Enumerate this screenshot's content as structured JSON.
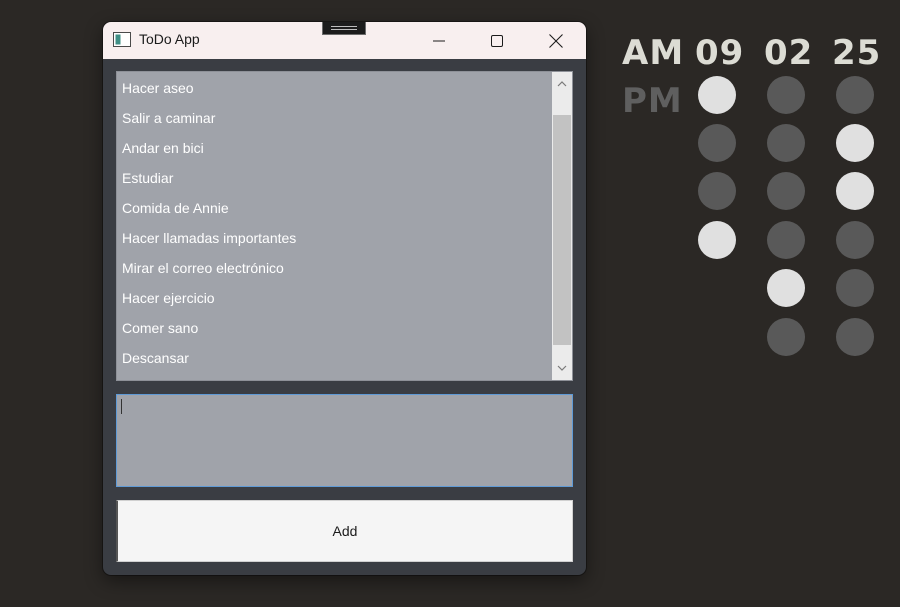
{
  "window": {
    "title": "ToDo App",
    "minimize_icon": "minimize-icon",
    "maximize_icon": "maximize-icon",
    "close_icon": "close-icon"
  },
  "todo_list": {
    "items": [
      "Hacer aseo",
      "Salir a caminar",
      "Andar en bici",
      "Estudiar",
      "Comida de Annie",
      "Hacer llamadas importantes",
      "Mirar el correo electrónico",
      "Hacer ejercicio",
      "Comer sano",
      "Descansar"
    ]
  },
  "new_item_input": {
    "value": ""
  },
  "add_button": {
    "label": "Add"
  },
  "clock": {
    "am_label": "AM",
    "pm_label": "PM",
    "active_period": "AM",
    "hours_label": "09",
    "minutes_label": "02",
    "seconds_label": "25",
    "colors": {
      "on": "#e0e0e0",
      "off": "#595959",
      "am_active": "#dcdcd4",
      "pm_inactive": "#5f5f5f"
    },
    "columns": [
      {
        "name": "hours",
        "bits": [
          1,
          0,
          0,
          1
        ]
      },
      {
        "name": "minutes",
        "bits": [
          0,
          0,
          0,
          0,
          1,
          0
        ]
      },
      {
        "name": "seconds",
        "bits": [
          0,
          1,
          1,
          0,
          0,
          0
        ]
      }
    ]
  }
}
